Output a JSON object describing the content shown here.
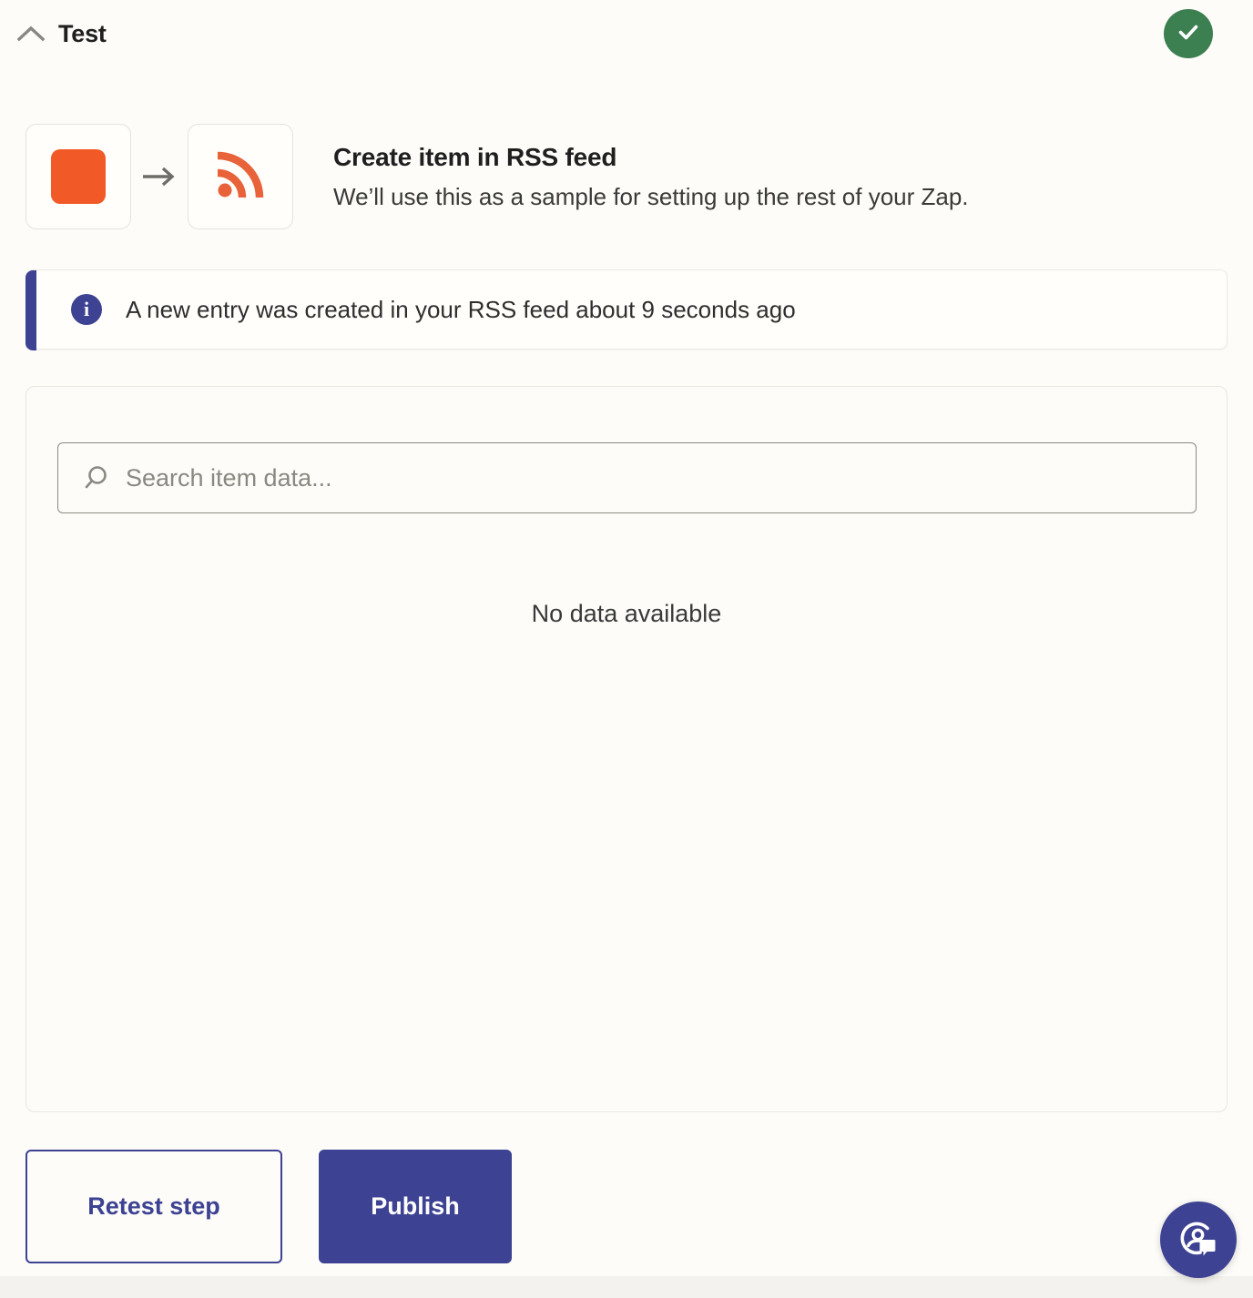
{
  "header": {
    "title": "Test",
    "collapse_icon": "chevron-up-icon",
    "status_icon": "check-circle-icon",
    "status_color": "#3c7f50"
  },
  "summary": {
    "source_app_icon": "orange-square-app-icon",
    "source_app_color": "#f15a26",
    "transition_icon": "arrow-right-icon",
    "target_app_icon": "rss-feed-icon",
    "target_app_color": "#e8623a",
    "title": "Create item in RSS feed",
    "subtitle": "We’ll use this as a sample for setting up the rest of your Zap."
  },
  "banner": {
    "icon": "info-circle-icon",
    "accent_color": "#3d4292",
    "message": "A new entry was created in your RSS feed about 9 seconds ago"
  },
  "data_panel": {
    "search": {
      "icon": "search-icon",
      "placeholder": "Search item data...",
      "value": ""
    },
    "empty_message": "No data available"
  },
  "actions": {
    "retest_label": "Retest step",
    "publish_label": "Publish",
    "primary_color": "#3d4292"
  },
  "support": {
    "icon": "support-chat-icon",
    "color": "#3d4292"
  }
}
